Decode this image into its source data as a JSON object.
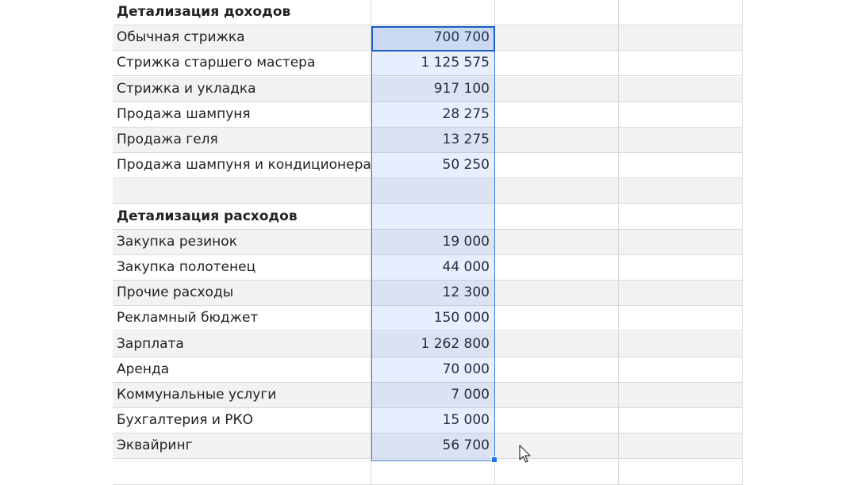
{
  "rows": [
    {
      "label": "Детализация доходов",
      "value": "",
      "bold": true
    },
    {
      "label": "Обычная стрижка",
      "value": "700 700"
    },
    {
      "label": "Стрижка старшего мастера",
      "value": "1 125 575"
    },
    {
      "label": "Стрижка и укладка",
      "value": "917 100"
    },
    {
      "label": "Продажа шампуня",
      "value": "28 275"
    },
    {
      "label": "Продажа геля",
      "value": "13 275"
    },
    {
      "label": "Продажа шампуня и кондиционера",
      "value": "50 250"
    },
    {
      "label": "",
      "value": ""
    },
    {
      "label": "Детализация расходов",
      "value": "",
      "bold": true
    },
    {
      "label": "Закупка резинок",
      "value": "19 000"
    },
    {
      "label": "Закупка полотенец",
      "value": "44 000"
    },
    {
      "label": "Прочие расходы",
      "value": "12 300"
    },
    {
      "label": "Рекламный бюджет",
      "value": "150 000"
    },
    {
      "label": "Зарплата",
      "value": "1 262 800"
    },
    {
      "label": "Аренда",
      "value": "70 000"
    },
    {
      "label": "Коммунальные услуги",
      "value": "7 000"
    },
    {
      "label": "Бухгалтерия и РКО",
      "value": "15 000"
    },
    {
      "label": "Эквайринг",
      "value": "56 700"
    },
    {
      "label": "",
      "value": ""
    }
  ],
  "colors": {
    "selection_border": "#3c78d8",
    "fill_handle": "#1a73e8",
    "row_shade": "#f2f2f2",
    "grid": "#d9d9d9"
  },
  "icons": {
    "cursor": "mouse-pointer-icon",
    "fill_handle": "fill-handle-icon"
  }
}
